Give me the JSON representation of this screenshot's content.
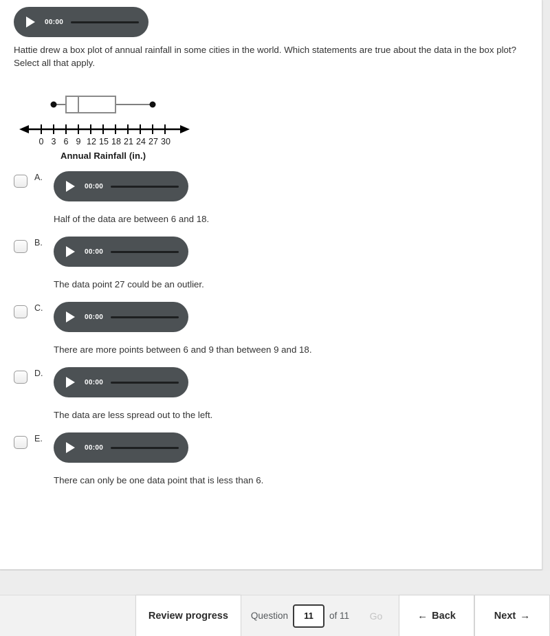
{
  "prompt": {
    "player": {
      "time": "00:00",
      "play_icon": "play-triangle-icon"
    },
    "line1": "Hattie drew a box plot of annual rainfall in some cities in the world. Which statements are true about the data in the box",
    "line2": "plot?",
    "line3": "Select all that apply."
  },
  "chart_data": {
    "type": "box",
    "title": "",
    "xlabel": "Annual Rainfall (in.)",
    "caption": "Annual Rainfall (in.)",
    "xlim": [
      0,
      30
    ],
    "tick_labels": [
      "0",
      "3",
      "6",
      "9",
      "12",
      "15",
      "18",
      "21",
      "24",
      "27",
      "30"
    ],
    "tick_values": [
      0,
      3,
      6,
      9,
      12,
      15,
      18,
      21,
      24,
      27,
      30
    ],
    "grid": false,
    "legend": "none",
    "axis_arrows": "both",
    "series": [
      {
        "name": "Annual Rainfall",
        "min": 3,
        "q1": 6,
        "median": 9,
        "q3": 18,
        "max": 27,
        "whisker_endpoint_marker": "filled-circle"
      }
    ]
  },
  "options": [
    {
      "letter": "A.",
      "checked": false,
      "player": {
        "time": "00:00",
        "play_icon": "play-triangle-icon"
      },
      "text": "Half of the data are between 6 and 18."
    },
    {
      "letter": "B.",
      "checked": false,
      "player": {
        "time": "00:00",
        "play_icon": "play-triangle-icon"
      },
      "text": "The data point 27 could be an outlier."
    },
    {
      "letter": "C.",
      "checked": false,
      "player": {
        "time": "00:00",
        "play_icon": "play-triangle-icon"
      },
      "text": "There are more points between 6 and 9 than between 9 and 18."
    },
    {
      "letter": "D.",
      "checked": false,
      "player": {
        "time": "00:00",
        "play_icon": "play-triangle-icon"
      },
      "text": "The data are less spread out to the left."
    },
    {
      "letter": "E.",
      "checked": false,
      "player": {
        "time": "00:00",
        "play_icon": "play-triangle-icon"
      },
      "text": "There can only be one data point that is less than 6."
    }
  ],
  "bottom_bar": {
    "review_label": "Review progress",
    "question_label": "Question",
    "question_value": "11",
    "of_label": "of 11",
    "go_label": "Go",
    "back_label": "Back",
    "next_label": "Next",
    "back_arrow": "←",
    "next_arrow": "→"
  }
}
